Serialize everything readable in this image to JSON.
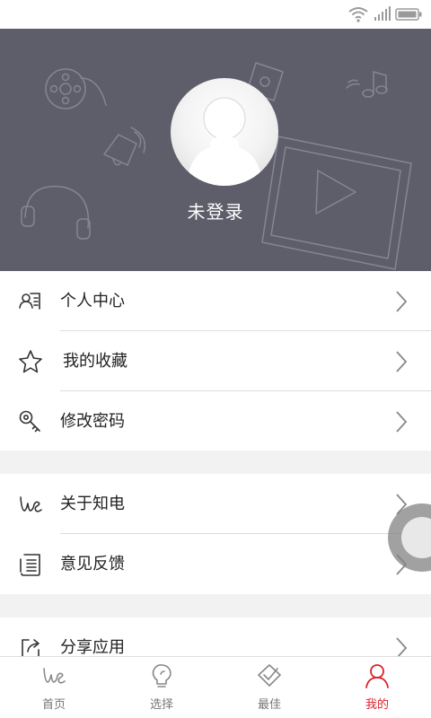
{
  "profile": {
    "login_status": "未登录"
  },
  "menu": {
    "group1": [
      {
        "label": "个人中心",
        "icon": "profile-card-icon"
      },
      {
        "label": "我的收藏",
        "icon": "star-icon"
      },
      {
        "label": "修改密码",
        "icon": "key-icon"
      }
    ],
    "group2": [
      {
        "label": "关于知电",
        "icon": "zhidian-logo-icon"
      },
      {
        "label": "意见反馈",
        "icon": "feedback-icon"
      }
    ],
    "group3": [
      {
        "label": "分享应用",
        "icon": "share-icon"
      }
    ]
  },
  "nav": {
    "tabs": [
      {
        "label": "首页",
        "icon": "home-logo-icon",
        "active": false
      },
      {
        "label": "选择",
        "icon": "lightbulb-icon",
        "active": false
      },
      {
        "label": "最佳",
        "icon": "badge-check-icon",
        "active": false
      },
      {
        "label": "我的",
        "icon": "user-icon",
        "active": true
      }
    ]
  },
  "colors": {
    "header_bg": "#5e5d6a",
    "accent": "#d9232f",
    "text": "#222222",
    "divider": "#dcdcdc"
  }
}
